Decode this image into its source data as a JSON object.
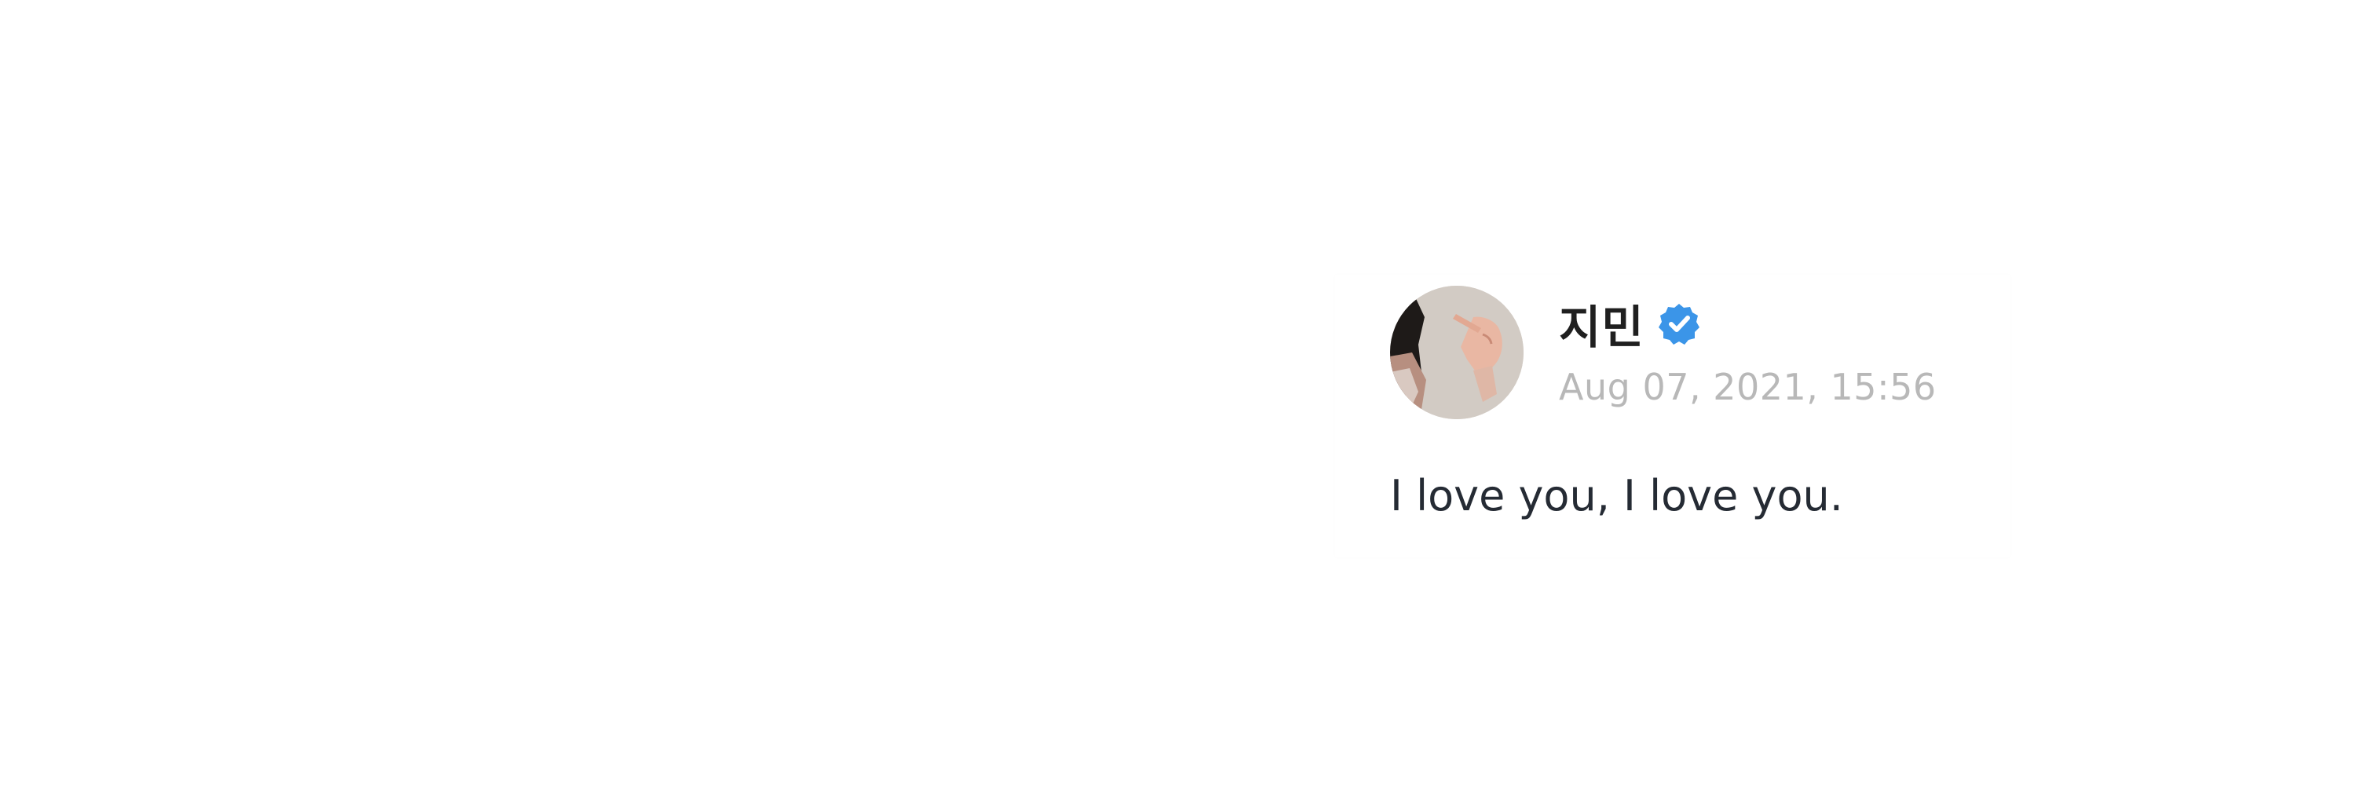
{
  "post": {
    "author_name": "지민",
    "verified": true,
    "timestamp": "Aug 07, 2021, 15:56",
    "text": "I love you, I love you."
  },
  "icons": {
    "verified": "verified-badge-icon",
    "avatar": "profile-photo"
  },
  "colors": {
    "verified_blue": "#3b95e8",
    "name_text": "#1f1f1f",
    "timestamp_text": "#b8b8b8",
    "body_text": "#252b34"
  }
}
